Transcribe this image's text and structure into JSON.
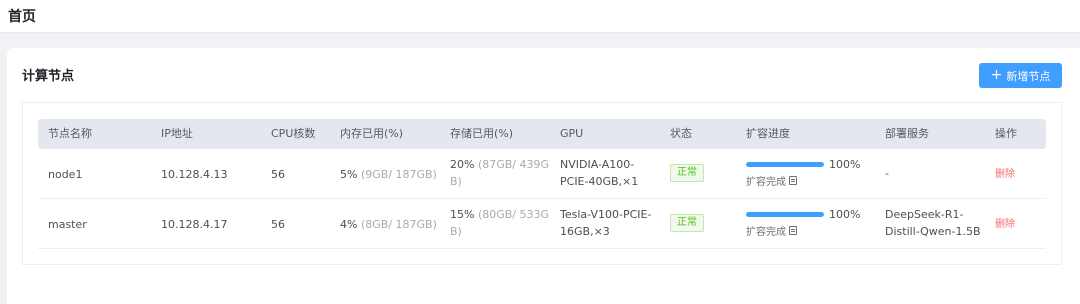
{
  "header": {
    "title": "首页"
  },
  "card": {
    "title": "计算节点",
    "add_button": "新增节点"
  },
  "table": {
    "columns": [
      "节点名称",
      "IP地址",
      "CPU核数",
      "内存已用(%)",
      "存储已用(%)",
      "GPU",
      "状态",
      "扩容进度",
      "部署服务",
      "操作"
    ],
    "rows": [
      {
        "name": "node1",
        "ip": "10.128.4.13",
        "cpu": "56",
        "mem_pct": "5%",
        "mem_detail": "(9GB/ 187GB)",
        "storage_pct": "20%",
        "storage_detail_1": "(87GB/ 439G",
        "storage_detail_2": "B)",
        "gpu_1": "NVIDIA-A100-",
        "gpu_2": "PCIE-40GB,×1",
        "status": "正常",
        "progress": 100,
        "progress_text": "100%",
        "progress_label": "扩容完成",
        "service_1": "-",
        "service_2": "",
        "action": "删除"
      },
      {
        "name": "master",
        "ip": "10.128.4.17",
        "cpu": "56",
        "mem_pct": "4%",
        "mem_detail": "(8GB/ 187GB)",
        "storage_pct": "15%",
        "storage_detail_1": "(80GB/ 533G",
        "storage_detail_2": "B)",
        "gpu_1": "Tesla-V100-PCIE-",
        "gpu_2": "16GB,×3",
        "status": "正常",
        "progress": 100,
        "progress_text": "100%",
        "progress_label": "扩容完成",
        "service_1": "DeepSeek-R1-",
        "service_2": "Distill-Qwen-1.5B",
        "action": "删除"
      }
    ]
  },
  "icons": {
    "add": "plus-icon",
    "report": "document-icon"
  },
  "colors": {
    "primary": "#409eff",
    "success": "#52c41a",
    "danger": "#f56c6c",
    "header_bg": "#e4e7ee"
  }
}
